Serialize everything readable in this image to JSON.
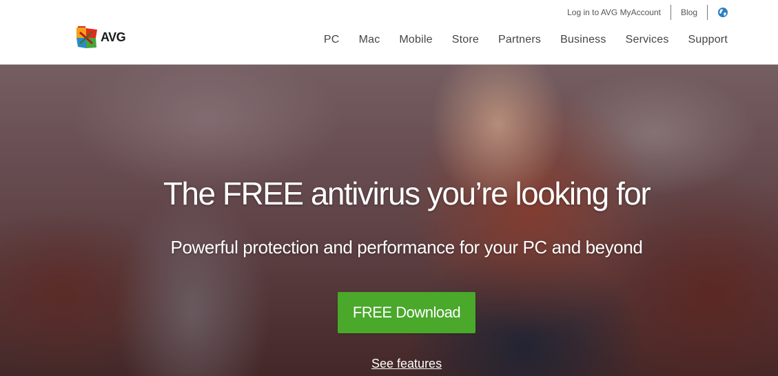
{
  "brand": {
    "name": "AVG",
    "logo_colors": [
      "#e32a1d",
      "#f4a11a",
      "#2b8ac6",
      "#45a73a"
    ]
  },
  "top_links": {
    "login": "Log in to AVG MyAccount",
    "blog": "Blog",
    "globe_icon": "globe-icon"
  },
  "main_nav": {
    "items": [
      {
        "label": "PC"
      },
      {
        "label": "Mac"
      },
      {
        "label": "Mobile"
      },
      {
        "label": "Store"
      },
      {
        "label": "Partners"
      },
      {
        "label": "Business"
      },
      {
        "label": "Services"
      },
      {
        "label": "Support"
      }
    ]
  },
  "hero": {
    "title": "The FREE antivirus you’re looking for",
    "subtitle": "Powerful protection and performance for your PC and beyond",
    "cta_label": "FREE Download",
    "cta_color": "#4aa82b",
    "secondary_link": "See features"
  }
}
